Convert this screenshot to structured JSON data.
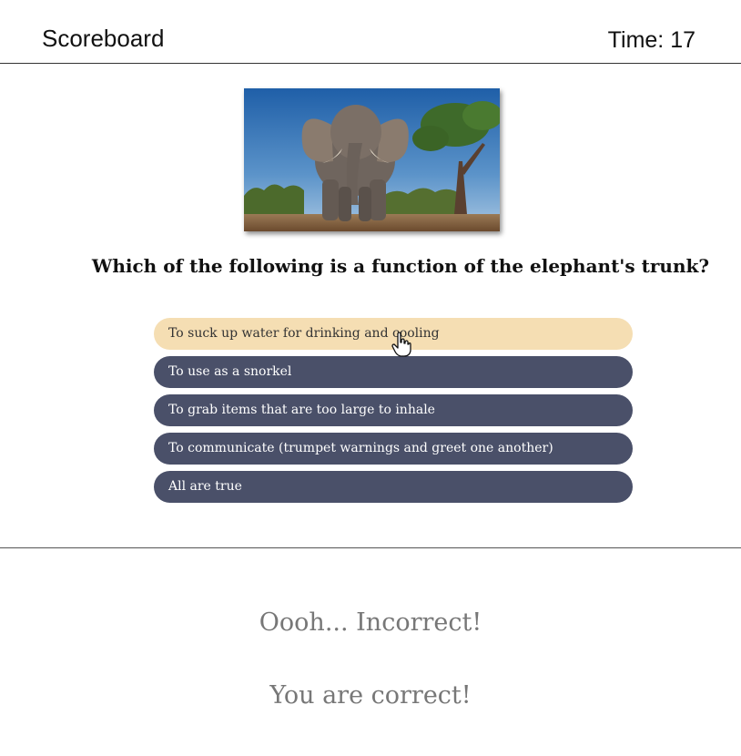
{
  "header": {
    "scoreboard_label": "Scoreboard",
    "timer_label": "Time: 17"
  },
  "question": {
    "image_icon": "elephant-photo",
    "text": "Which of the following is a function of the elephant's trunk?"
  },
  "answers": [
    {
      "label": "To suck up water for drinking and cooling",
      "state": "hover"
    },
    {
      "label": "To use as a snorkel",
      "state": "default"
    },
    {
      "label": "To grab items that are too large to inhale",
      "state": "default"
    },
    {
      "label": "To communicate (trumpet warnings and greet one another)",
      "state": "default"
    },
    {
      "label": "All are true",
      "state": "default"
    }
  ],
  "feedback": {
    "incorrect": "Oooh... Incorrect!",
    "correct": "You are correct!"
  },
  "colors": {
    "answer_bg": "#4a5069",
    "answer_hover_bg": "#f5deb3",
    "feedback_text": "#777777"
  }
}
